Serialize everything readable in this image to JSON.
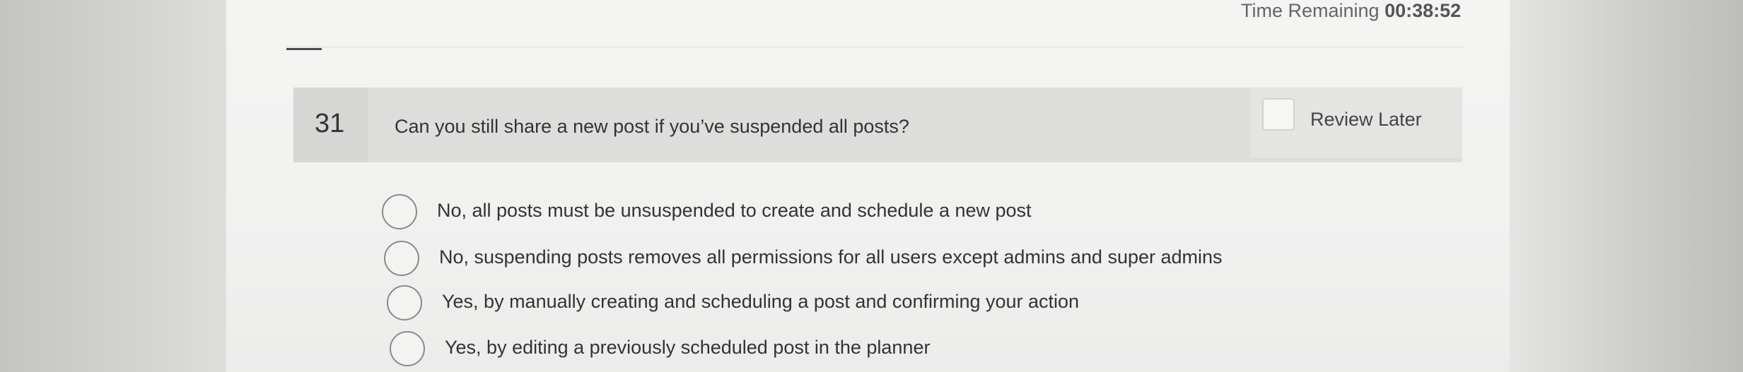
{
  "timer": {
    "label": "Time Remaining",
    "value": "00:38:52"
  },
  "question": {
    "number": "31",
    "text": "Can you still share a new post if you’ve suspended all posts?",
    "review_label": "Review Later",
    "review_checked": false
  },
  "options": [
    {
      "label": "No, all posts must be unsuspended to create and schedule a new post",
      "selected": false
    },
    {
      "label": "No, suspending posts removes all permissions for all users except admins and super admins",
      "selected": false
    },
    {
      "label": "Yes, by manually creating and scheduling a post and confirming your action",
      "selected": false
    },
    {
      "label": "Yes, by editing a previously scheduled post in the planner",
      "selected": false
    }
  ]
}
